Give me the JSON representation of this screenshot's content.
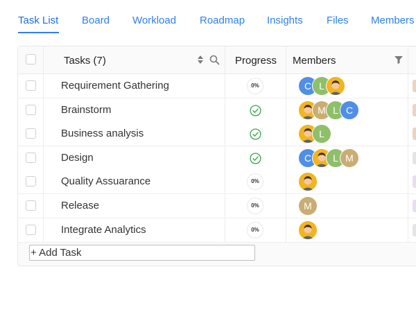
{
  "tabs": [
    {
      "label": "Task List",
      "active": true
    },
    {
      "label": "Board"
    },
    {
      "label": "Workload"
    },
    {
      "label": "Roadmap"
    },
    {
      "label": "Insights"
    },
    {
      "label": "Files"
    },
    {
      "label": "Members"
    }
  ],
  "table": {
    "headers": {
      "tasks": "Tasks (7)",
      "progress": "Progress",
      "members": "Members"
    },
    "rows": [
      {
        "name": "Requirement Gathering",
        "progress": "0%",
        "done": false,
        "members": [
          "C",
          "L",
          "photo"
        ],
        "tag_color": "#ecd3c6"
      },
      {
        "name": "Brainstorm",
        "progress": "",
        "done": true,
        "members": [
          "photo",
          "M",
          "L",
          "C"
        ],
        "tag_color": "#ecd3c6"
      },
      {
        "name": "Business analysis",
        "progress": "",
        "done": true,
        "members": [
          "photo",
          "L"
        ],
        "tag_color": "#ecd3c6"
      },
      {
        "name": "Design",
        "progress": "",
        "done": true,
        "members": [
          "C",
          "photo",
          "L",
          "M"
        ],
        "tag_color": "#e4e4e4"
      },
      {
        "name": "Quality Assuarance",
        "progress": "0%",
        "done": false,
        "members": [
          "photo"
        ],
        "tag_color": "#eadcf0"
      },
      {
        "name": "Release",
        "progress": "0%",
        "done": false,
        "members": [
          "M"
        ],
        "tag_color": "#eadcf0"
      },
      {
        "name": "Integrate Analytics",
        "progress": "0%",
        "done": false,
        "members": [
          "photo"
        ],
        "tag_color": "#e4e4e4"
      }
    ],
    "add_task_label": "+ Add Task"
  },
  "colors": {
    "accent": "#2f80ed",
    "check_green": "#3aa34a",
    "avatar_c": "#4f8fe6",
    "avatar_l": "#8fbf6a",
    "avatar_m": "#c9ad72",
    "avatar_photo_bg": "#f2b51f"
  },
  "icons": {
    "sort": "sort-icon",
    "search": "search-icon",
    "filter": "filter-icon",
    "done": "check-circle-icon"
  }
}
